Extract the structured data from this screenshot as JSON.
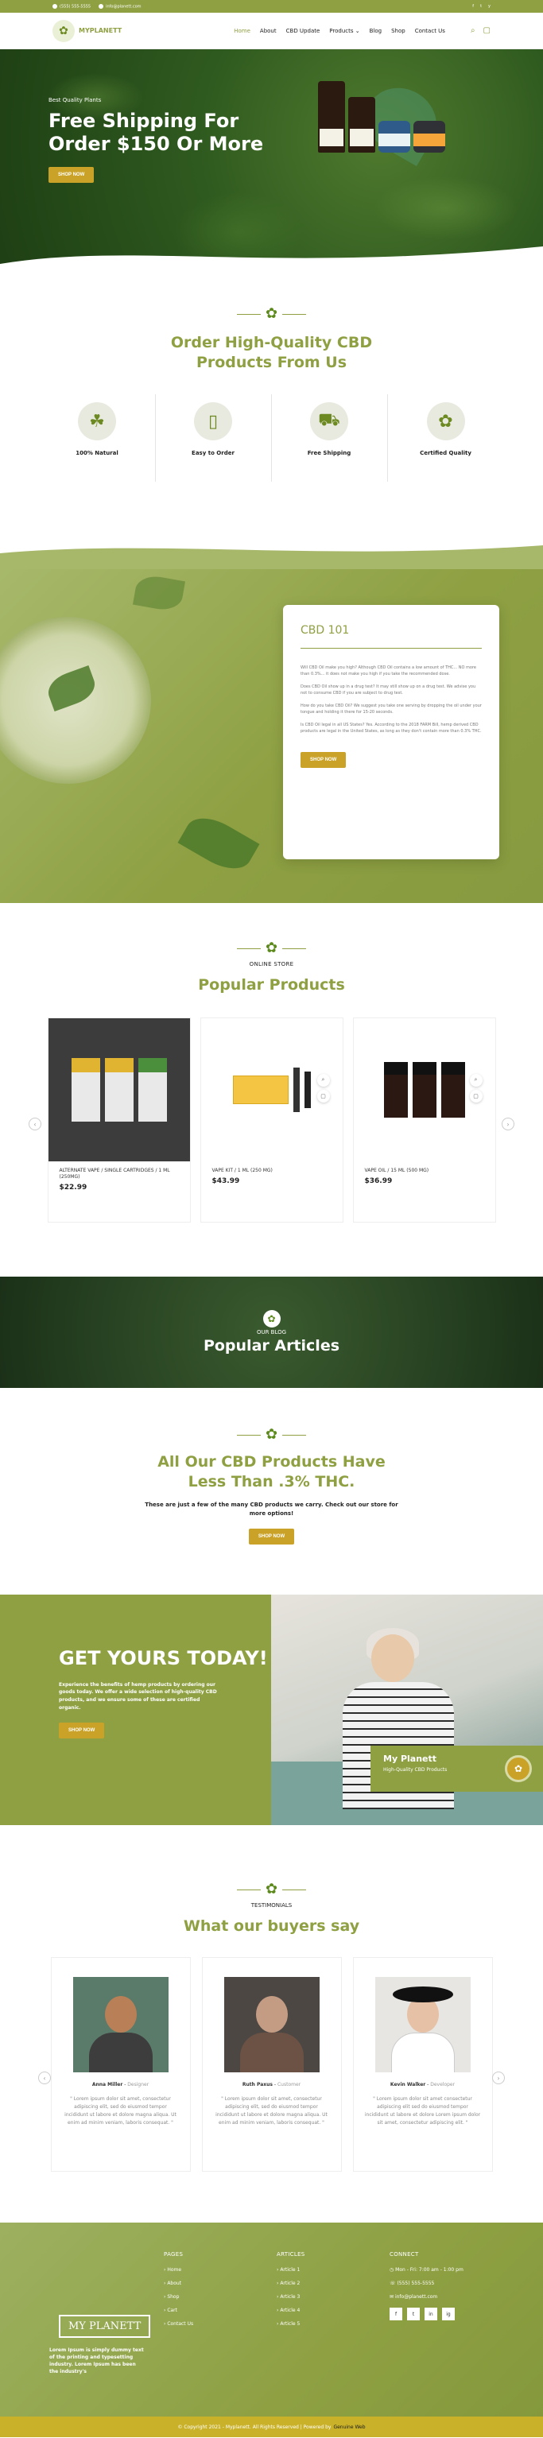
{
  "topbar": {
    "phone": "(555) 555-5555",
    "email": "info@planett.com",
    "social": [
      "f",
      "t",
      "y"
    ]
  },
  "header": {
    "logo_text": "MYPLANETT",
    "nav": [
      "Home",
      "About",
      "CBD Update",
      "Products ⌄",
      "Blog",
      "Shop",
      "Contact Us"
    ],
    "icons": [
      "search-icon",
      "bag-icon"
    ]
  },
  "hero": {
    "kicker": "Best Quality Plants",
    "title": "Free Shipping For Order $150 Or More",
    "button": "SHOP NOW"
  },
  "features": {
    "title": "Order High-Quality CBD Products From Us",
    "items": [
      {
        "label": "100% Natural",
        "icon": "leaf-icon"
      },
      {
        "label": "Easy to Order",
        "icon": "phone-icon"
      },
      {
        "label": "Free Shipping",
        "icon": "truck-icon"
      },
      {
        "label": "Certified Quality",
        "icon": "cannabis-icon"
      }
    ]
  },
  "cbd101": {
    "title": "CBD 101",
    "paragraphs": [
      "Will CBD Oil make you high? Although CBD Oil contains a low amount of THC... NO more than 0.3%... it does not make you high if you take the recommended dose.",
      "Does CBD Oil show up in a drug test? It may still show up on a drug test. We advise you not to consume CBD if you are subject to drug test.",
      "How do you take CBD Oil? We suggest you take one serving by dropping the oil under your tongue and holding it there for 15-20 seconds.",
      "Is CBD Oil legal in all US States? Yes. According to the 2018 FARM Bill, hemp derived CBD products are legal in the United States, as long as they don't contain more than 0.3% THC."
    ],
    "button": "SHOP NOW"
  },
  "products": {
    "kicker": "ONLINE STORE",
    "title": "Popular Products",
    "items": [
      {
        "name": "ALTERNATE VAPE / SINGLE CARTRIDGES / 1 ML (250MG)",
        "price": "$22.99"
      },
      {
        "name": "VAPE KIT / 1 ML (250 MG)",
        "price": "$43.99"
      },
      {
        "name": "VAPE OIL / 15 ML (500 MG)",
        "price": "$36.99"
      }
    ]
  },
  "blog": {
    "kicker": "OUR BLOG",
    "title": "Popular Articles"
  },
  "promo": {
    "title": "All Our CBD Products Have Less Than .3% THC.",
    "sub": "These are just a few of the many CBD products we carry. Check out our store for more options!",
    "button": "SHOP NOW"
  },
  "getyours": {
    "title": "GET YOURS TODAY!",
    "text": "Experience the benefits of hemp products by ordering our goods today. We offer a wide selection of high-quality CBD products, and we ensure some of these are certified organic.",
    "button": "SHOP NOW",
    "card_title": "My Planett",
    "card_sub": "High-Quality CBD Products"
  },
  "testimonials": {
    "kicker": "TESTIMONIALS",
    "title": "What our buyers say",
    "items": [
      {
        "name": "Anna Miller",
        "role": "Designer",
        "quote": "\" Lorem ipsum dolor sit amet, consectetur adipiscing elit, sed do eiusmod tempor incididunt ut labore et dolore magna aliqua. Ut enim ad minim veniam, laboris consequat. \""
      },
      {
        "name": "Ruth Paxus",
        "role": "Customer",
        "quote": "\" Lorem ipsum dolor sit amet, consectetur adipiscing elit, sed do eiusmod tempor incididunt ut labore et dolore magna aliqua. Ut enim ad minim veniam, laboris consequat. \""
      },
      {
        "name": "Kevin Walker",
        "role": "Developer",
        "quote": "\" Lorem ipsum dolor sit amet consectetur adipiscing elit sed do eiusmod tempor incididunt ut labore et dolore Lorem ipsum dolor sit amet, consectetur adipiscing elit. \""
      }
    ]
  },
  "footer": {
    "logo": "MY PLANETT",
    "desc": "Lorem Ipsum is simply dummy text of the printing and typesetting industry. Lorem Ipsum has been the industry's",
    "pages_title": "PAGES",
    "pages": [
      "Home",
      "About",
      "Shop",
      "Cart",
      "Contact Us"
    ],
    "articles_title": "ARTICLES",
    "articles": [
      "Article 1",
      "Article 2",
      "Article 3",
      "Article 4",
      "Article 5"
    ],
    "connect_title": "CONNECT",
    "hours": "Mon - Fri: 7:00 am - 1:00 pm",
    "phone": "(555) 555-5555",
    "email": "info@planett.com",
    "social": [
      "f",
      "t",
      "in",
      "ig"
    ],
    "copyright": "© Copyright 2021 - Myplanett. All Rights Reserved | Powered by",
    "powered": "Genuine Web"
  }
}
